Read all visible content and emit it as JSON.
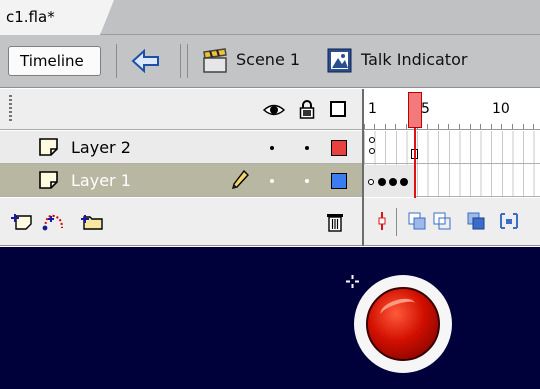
{
  "document_tab": {
    "title": "c1.fla*"
  },
  "edit_bar": {
    "timeline_button": "Timeline",
    "scene_label": "Scene 1",
    "symbol_label": "Talk Indicator"
  },
  "timeline": {
    "ruler": {
      "labels": [
        "1",
        "5",
        "10"
      ],
      "current_frame": 4
    },
    "layers": [
      {
        "name": "Layer 2",
        "color": "#e94040",
        "selected": false,
        "editing": false
      },
      {
        "name": "Layer 1",
        "color": "#3a7df0",
        "selected": true,
        "editing": true
      }
    ]
  },
  "stage": {
    "background": "#00003a"
  },
  "icons": {
    "eye": "eye-icon",
    "lock": "lock-icon",
    "outline": "outline-icon",
    "layer": "layer-icon",
    "pencil": "pencil-icon",
    "trash": "trash-icon",
    "back": "back-arrow-icon",
    "scene": "scene-clapper-icon",
    "symbol": "symbol-icon"
  }
}
